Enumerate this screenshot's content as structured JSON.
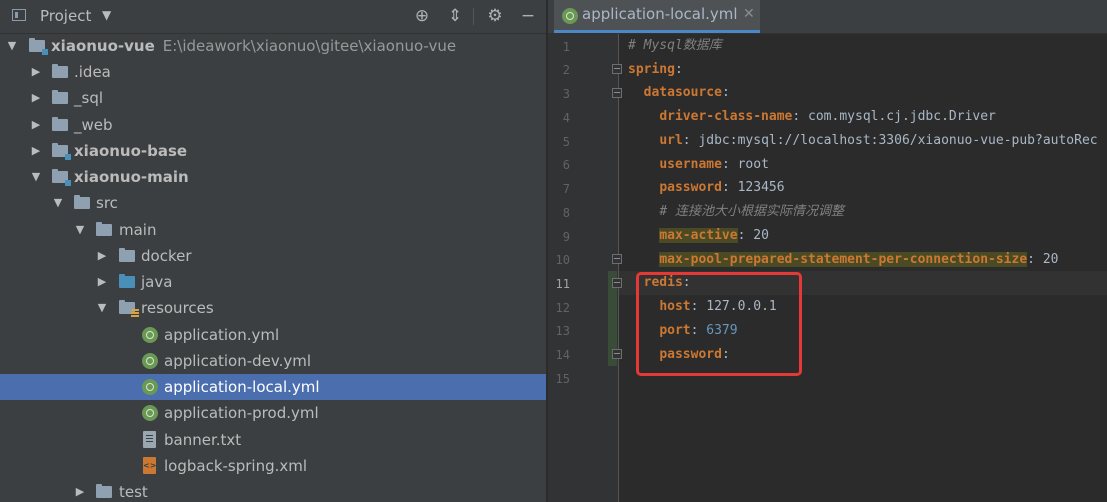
{
  "project_panel": {
    "title": "Project",
    "tree": [
      {
        "label": "xiaonuo-vue",
        "path": "E:\\ideawork\\xiaonuo\\gitee\\xiaonuo-vue"
      },
      {
        "label": ".idea"
      },
      {
        "label": "_sql"
      },
      {
        "label": "_web"
      },
      {
        "label": "xiaonuo-base"
      },
      {
        "label": "xiaonuo-main"
      },
      {
        "label": "src"
      },
      {
        "label": "main"
      },
      {
        "label": "docker"
      },
      {
        "label": "java"
      },
      {
        "label": "resources"
      },
      {
        "label": "application.yml"
      },
      {
        "label": "application-dev.yml"
      },
      {
        "label": "application-local.yml"
      },
      {
        "label": "application-prod.yml"
      },
      {
        "label": "banner.txt"
      },
      {
        "label": "logback-spring.xml"
      },
      {
        "label": "test"
      }
    ]
  },
  "editor": {
    "tab_label": "application-local.yml",
    "line_numbers": [
      "1",
      "2",
      "3",
      "4",
      "5",
      "6",
      "7",
      "8",
      "9",
      "10",
      "11",
      "12",
      "13",
      "14",
      "15"
    ],
    "code": {
      "l1_comment": "# Mysql数据库",
      "l2_key": "spring",
      "l3_key": "datasource",
      "l4_key": "driver-class-name",
      "l4_val": "com.mysql.cj.jdbc.Driver",
      "l5_key": "url",
      "l5_val": "jdbc:mysql://localhost:3306/xiaonuo-vue-pub?autoRec",
      "l6_key": "username",
      "l6_val": "root",
      "l7_key": "password",
      "l7_val": "123456",
      "l8_comment": "# 连接池大小根据实际情况调整",
      "l9_key": "max-active",
      "l9_val": "20",
      "l10_key": "max-pool-prepared-statement-per-connection-size",
      "l10_val": "20",
      "l11_key": "redis",
      "l12_key": "host",
      "l12_val": "127.0.0.1",
      "l13_key": "port",
      "l13_val": "6379",
      "l14_key": "password"
    }
  },
  "colors": {
    "selection": "#4b6eaf",
    "annotation_box": "#e53935",
    "yaml_key": "#cc7832",
    "comment": "#808080",
    "number": "#6897bb"
  }
}
